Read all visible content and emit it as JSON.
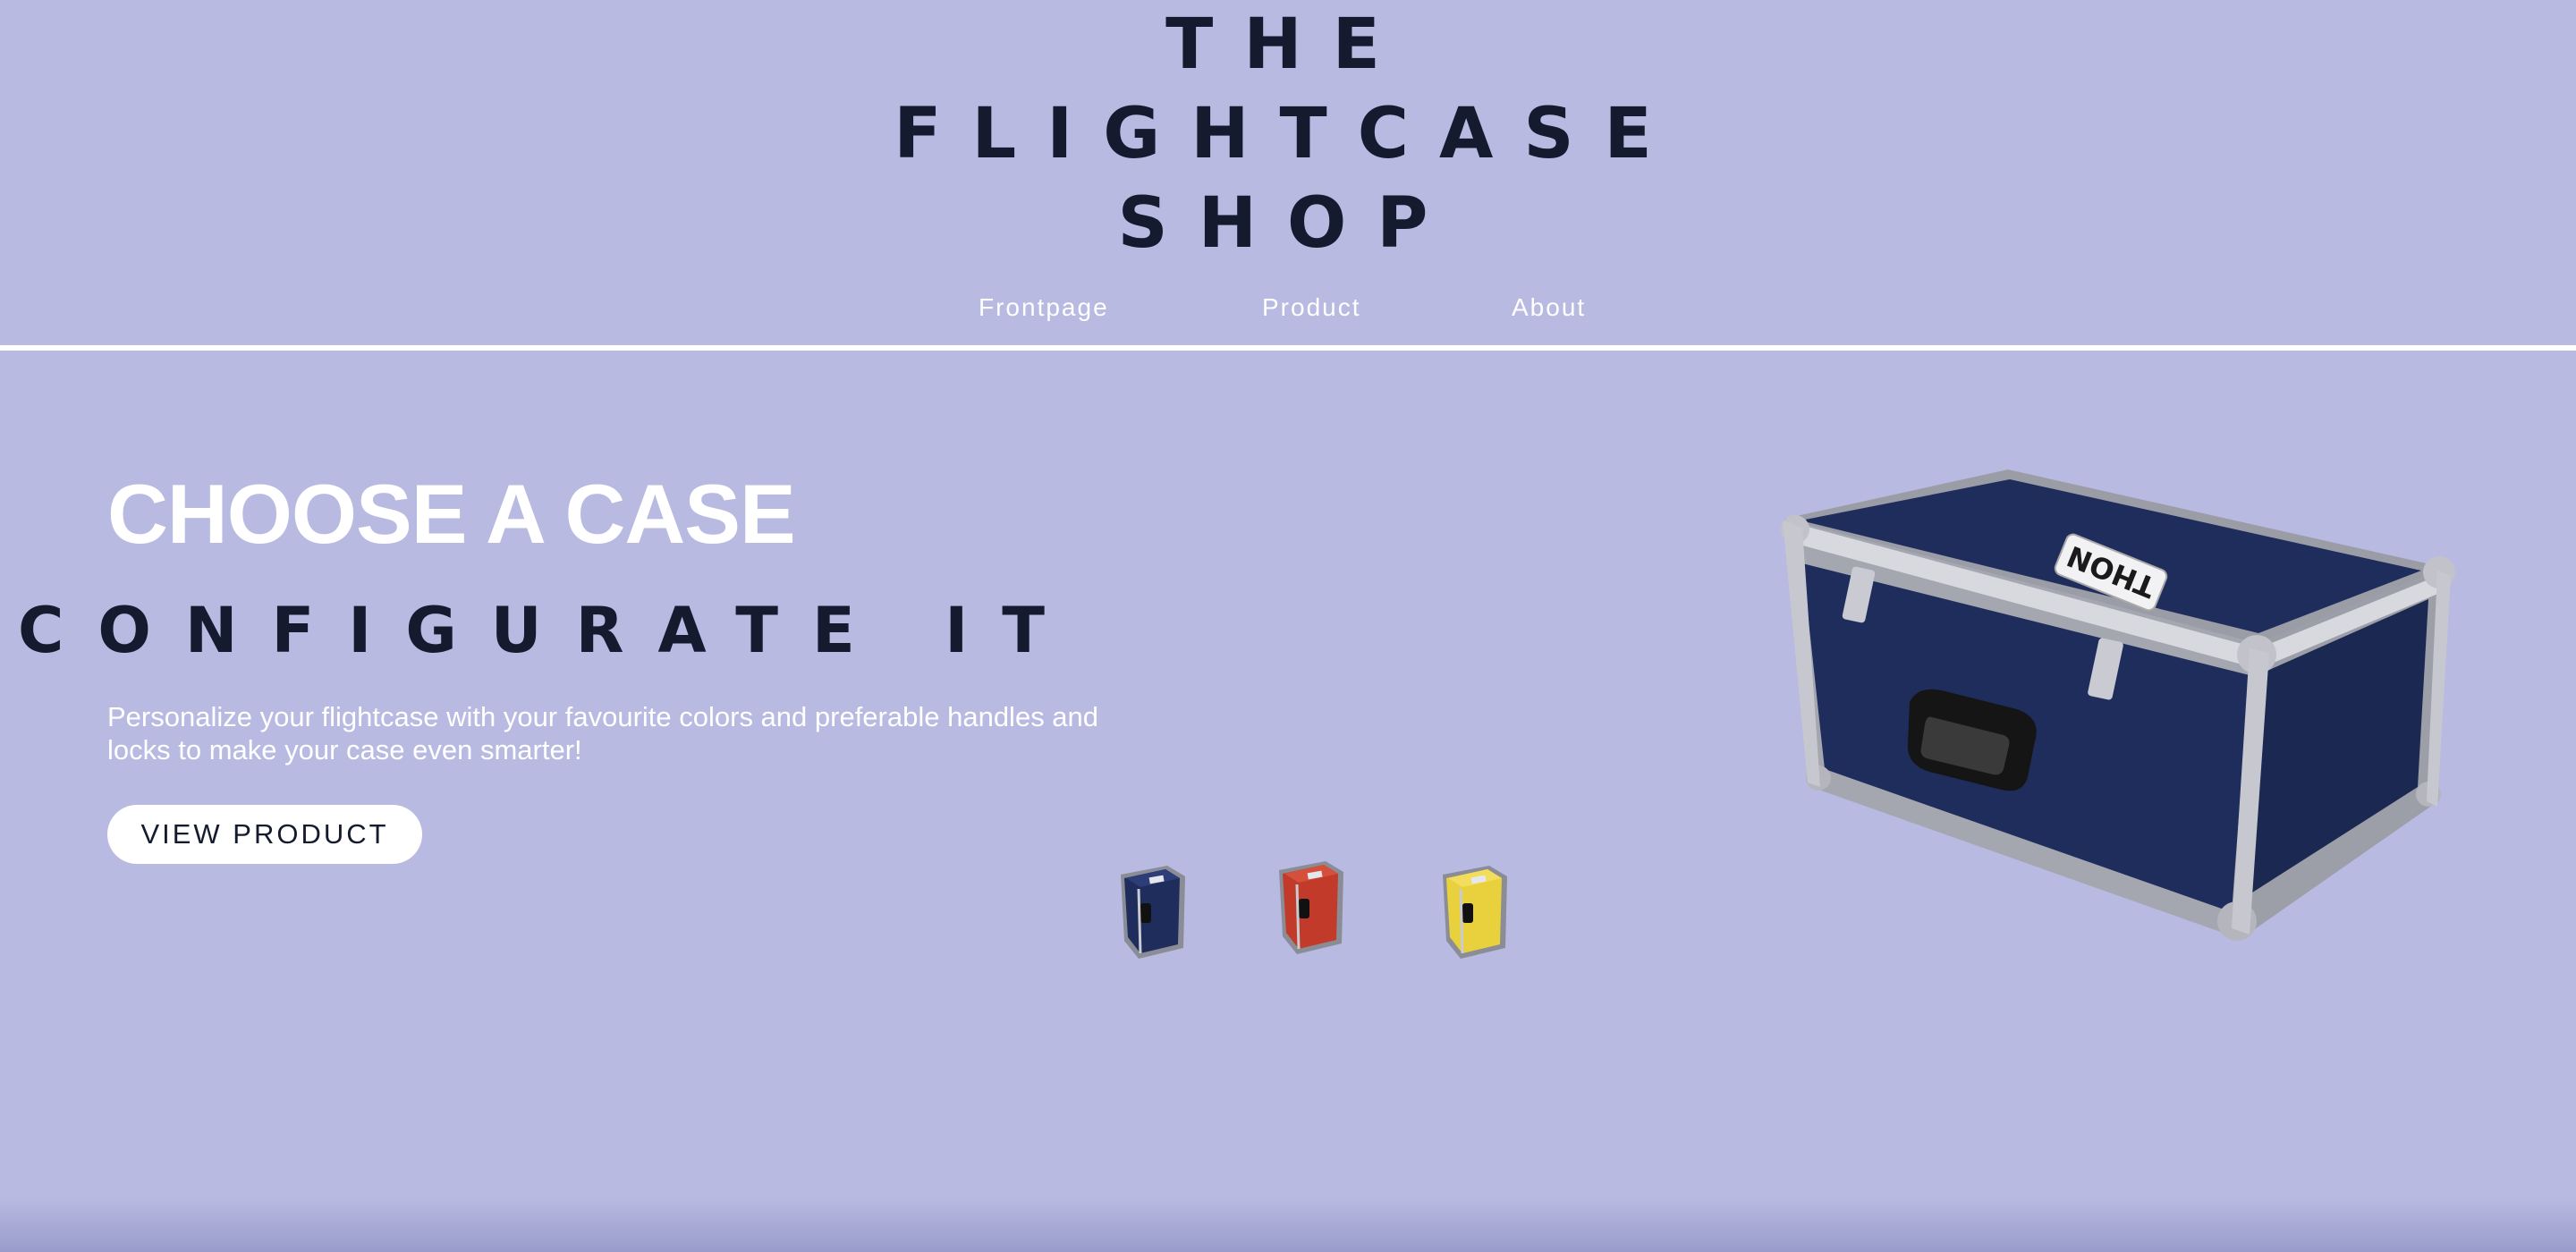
{
  "header": {
    "logo_lines": [
      "THE",
      "FLIGHTCASE",
      "SHOP"
    ],
    "nav": [
      {
        "label": "Frontpage"
      },
      {
        "label": "Product"
      },
      {
        "label": "About"
      }
    ]
  },
  "hero": {
    "headline": "CHOOSE A CASE",
    "subheadline": "CONFIGURATE IT",
    "description": "Personalize your flightcase with your favourite colors and preferable handles and locks to make your case even smarter!",
    "cta_label": "VIEW PRODUCT",
    "hero_case_brand": "THON"
  },
  "color_options": [
    {
      "name": "blue",
      "color": "#1f2d5c"
    },
    {
      "name": "red",
      "color": "#c23a2a"
    },
    {
      "name": "yellow",
      "color": "#e8d13c"
    }
  ],
  "colors": {
    "background": "#b8bae2",
    "dark_text": "#141b2e",
    "white": "#ffffff",
    "case_blue": "#1f2d5c"
  }
}
